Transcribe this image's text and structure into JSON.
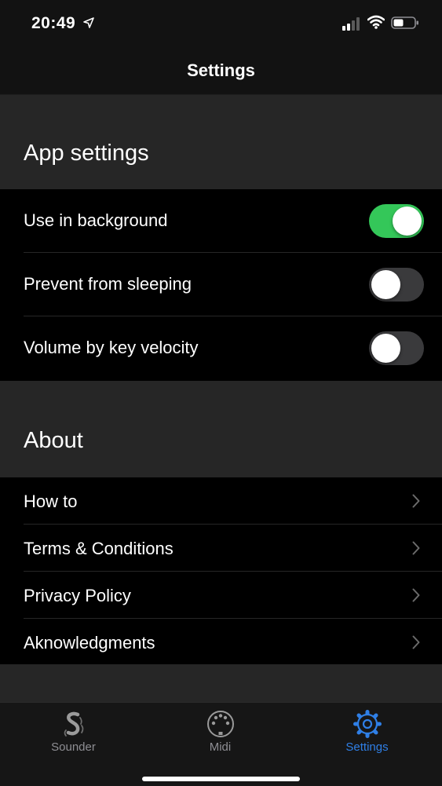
{
  "status": {
    "time": "20:49"
  },
  "nav": {
    "title": "Settings"
  },
  "app_settings": {
    "header": "App settings",
    "items": [
      {
        "label": "Use in background",
        "enabled": true
      },
      {
        "label": "Prevent from sleeping",
        "enabled": false
      },
      {
        "label": "Volume by key velocity",
        "enabled": false
      }
    ]
  },
  "about": {
    "header": "About",
    "items": [
      {
        "label": "How to"
      },
      {
        "label": "Terms & Conditions"
      },
      {
        "label": "Privacy Policy"
      },
      {
        "label": "Aknowledgments"
      }
    ]
  },
  "tabs": [
    {
      "label": "Sounder",
      "icon": "sounder-icon",
      "active": false
    },
    {
      "label": "Midi",
      "icon": "midi-connector-icon",
      "active": false
    },
    {
      "label": "Settings",
      "icon": "gear-icon",
      "active": true
    }
  ],
  "colors": {
    "accent": "#2f7fe6",
    "toggle_on": "#34c759",
    "section_bg": "#262626"
  }
}
